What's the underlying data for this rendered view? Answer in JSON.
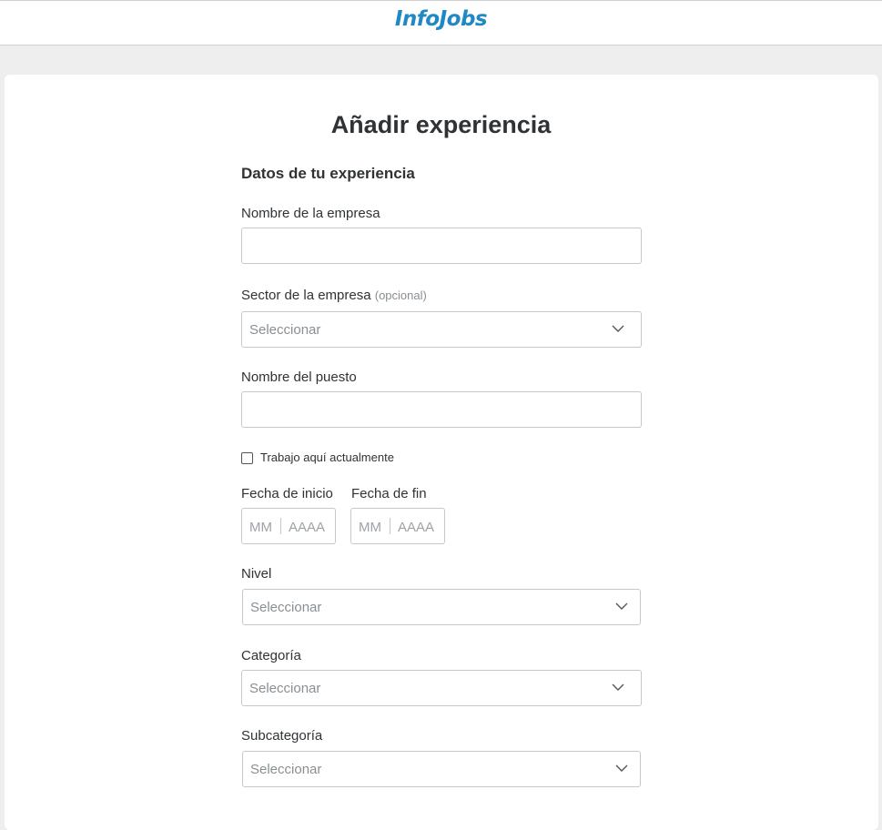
{
  "header": {
    "logo_text": "InfoJobs",
    "brand_color": "#2088c2"
  },
  "form": {
    "title": "Añadir experiencia",
    "section_title": "Datos de tu experiencia",
    "company_name_label": "Nombre de la empresa",
    "company_name_value": "",
    "sector_label": "Sector de la empresa",
    "sector_optional": "(opcional)",
    "sector_value": "Seleccionar",
    "job_title_label": "Nombre del puesto",
    "job_title_value": "",
    "current_job_label": "Trabajo aquí actualmente",
    "current_job_checked": false,
    "start_date_label": "Fecha de inicio",
    "end_date_label": "Fecha de fin",
    "month_placeholder": "MM",
    "year_placeholder": "AAAA",
    "level_label": "Nivel",
    "level_value": "Seleccionar",
    "category_label": "Categoría",
    "category_value": "Seleccionar",
    "subcategory_label": "Subcategoría",
    "subcategory_value": "Seleccionar",
    "chevron_icon": "chevron-down-icon"
  }
}
